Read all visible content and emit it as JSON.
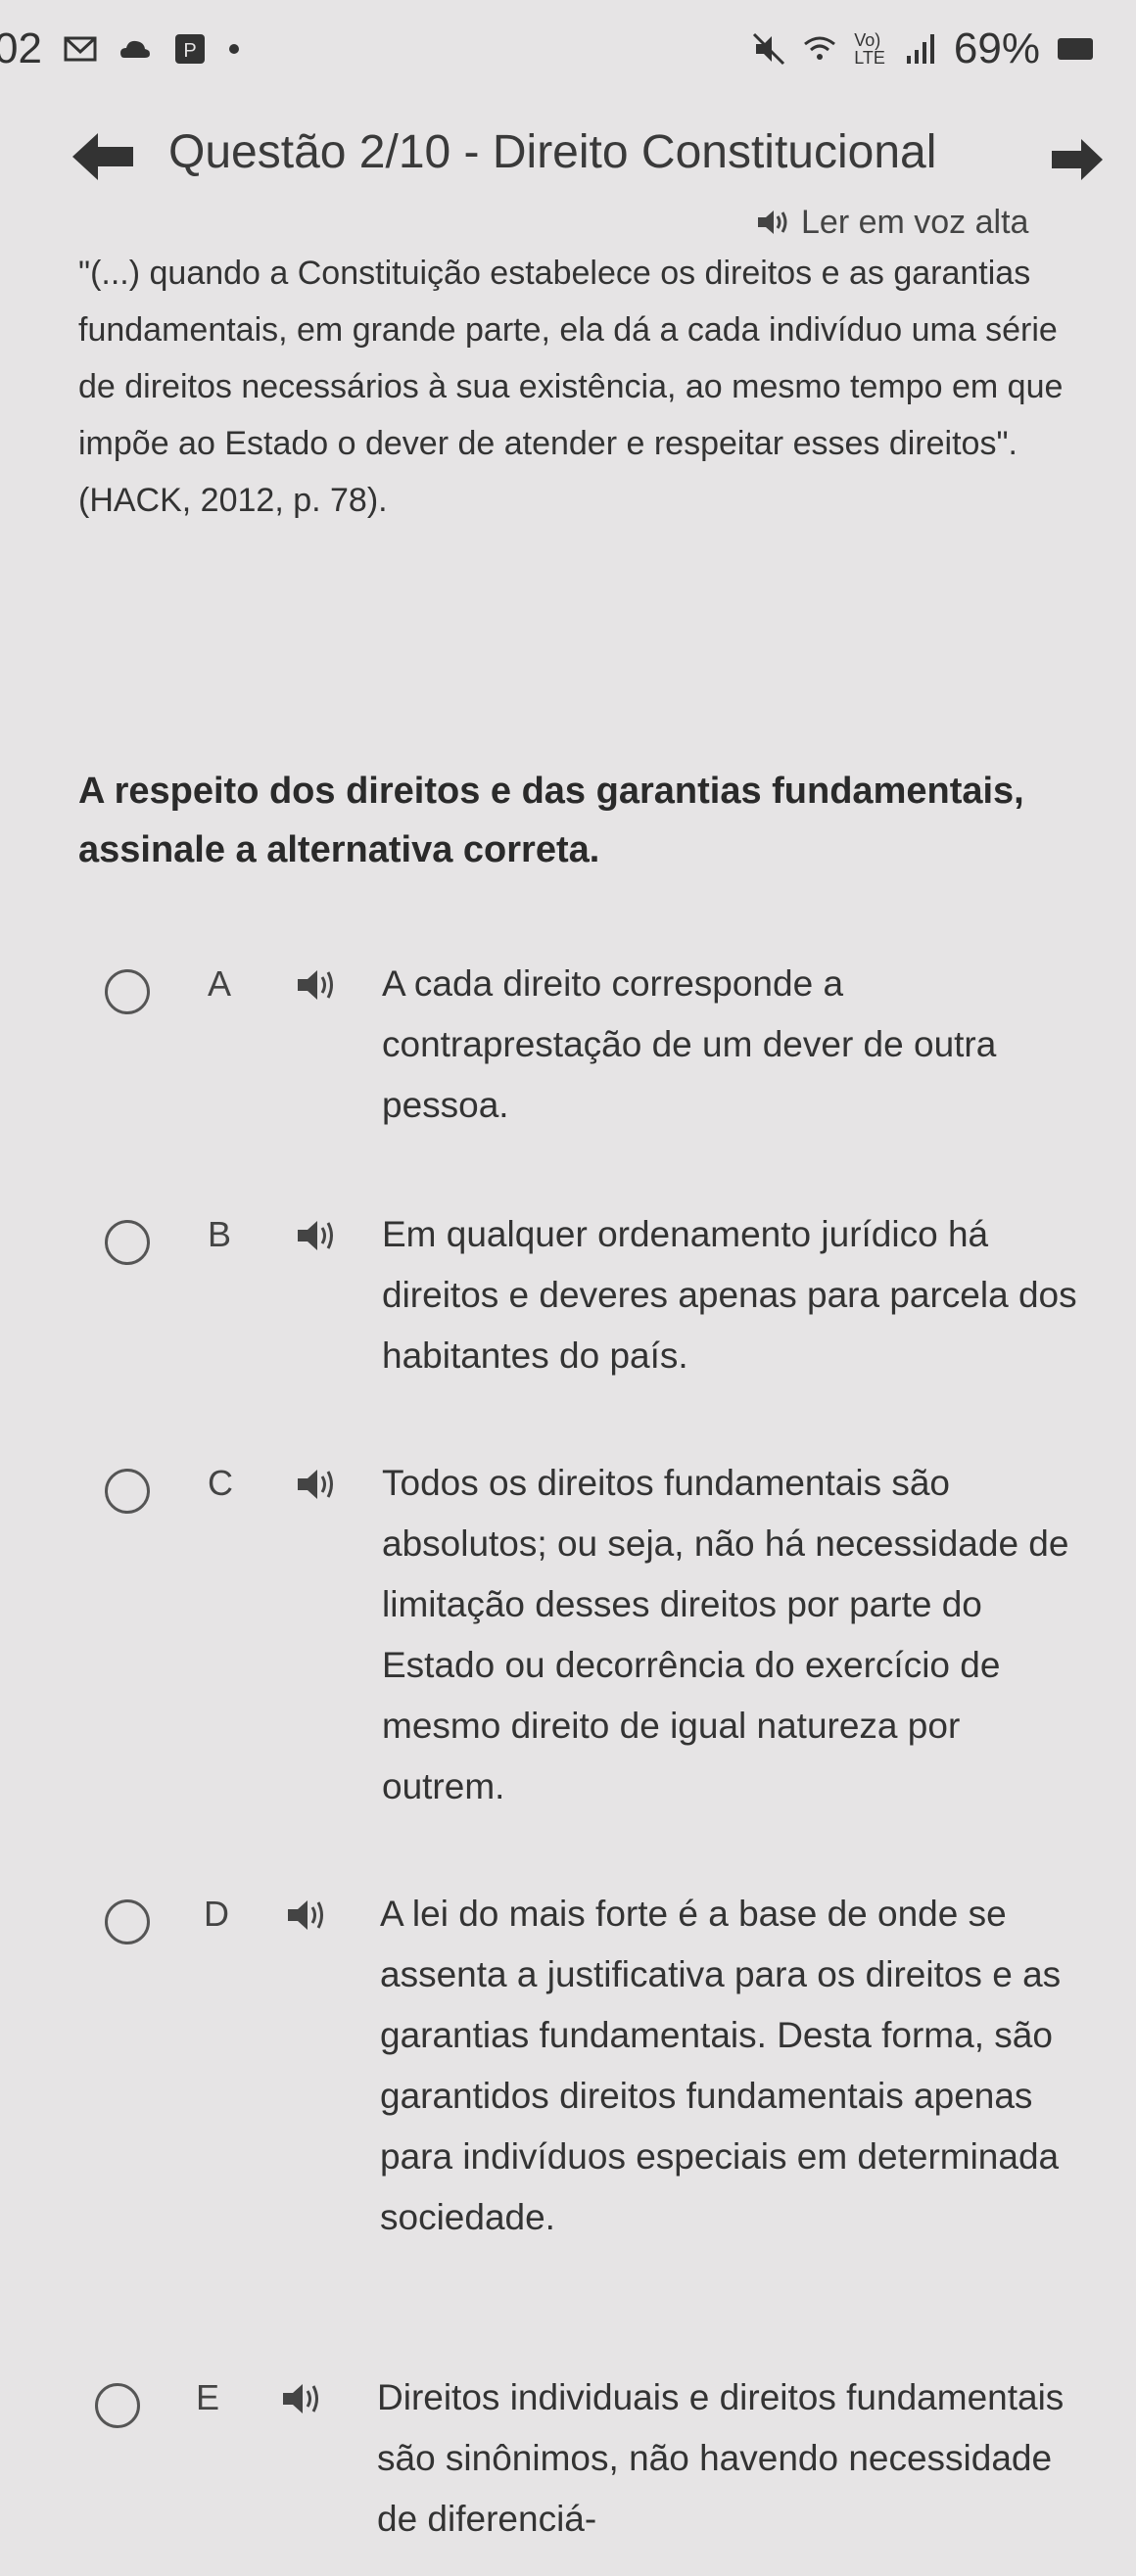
{
  "status_bar": {
    "time_fragment": "02",
    "gmail_glyph": "M",
    "p_badge": "P",
    "network_label": "Vo)\nLTE",
    "battery_percent": "69%"
  },
  "header": {
    "title": "Questão 2/10 - Direito Constitucional"
  },
  "tts": {
    "label": "Ler em voz alta"
  },
  "quote_text": "\"(...) quando a Constituição estabelece os direitos e as garantias fundamentais, em grande parte, ela dá a cada indivíduo uma série de direitos necessários à sua existência, ao mesmo tempo em que impõe ao Estado o dever de atender e respeitar esses direitos\". (HACK, 2012, p. 78).",
  "question_text": "A respeito dos direitos e das garantias fundamentais, assinale a alternativa correta.",
  "alternatives": [
    {
      "letter": "A",
      "text": "A cada direito corresponde a contraprestação de um dever de outra pessoa."
    },
    {
      "letter": "B",
      "text": "Em qualquer ordenamento jurídico há direitos e deveres apenas para parcela dos habitantes do país."
    },
    {
      "letter": "C",
      "text": "Todos os direitos fundamentais são absolutos; ou seja, não há necessidade de limitação desses direitos por parte do Estado ou decorrência do exercício de mesmo direito de igual natureza por outrem."
    },
    {
      "letter": "D",
      "text": "A lei do mais forte é a base de onde se assenta a justificativa para os direitos e as garantias fundamentais. Desta forma, são garantidos direitos fundamentais apenas para indivíduos especiais em determinada sociedade."
    },
    {
      "letter": "E",
      "text": "Direitos individuais e direitos fundamentais são sinônimos, não havendo necessidade de diferenciá-"
    }
  ],
  "colors": {
    "background": "#e6e4e5",
    "text": "#333333"
  }
}
